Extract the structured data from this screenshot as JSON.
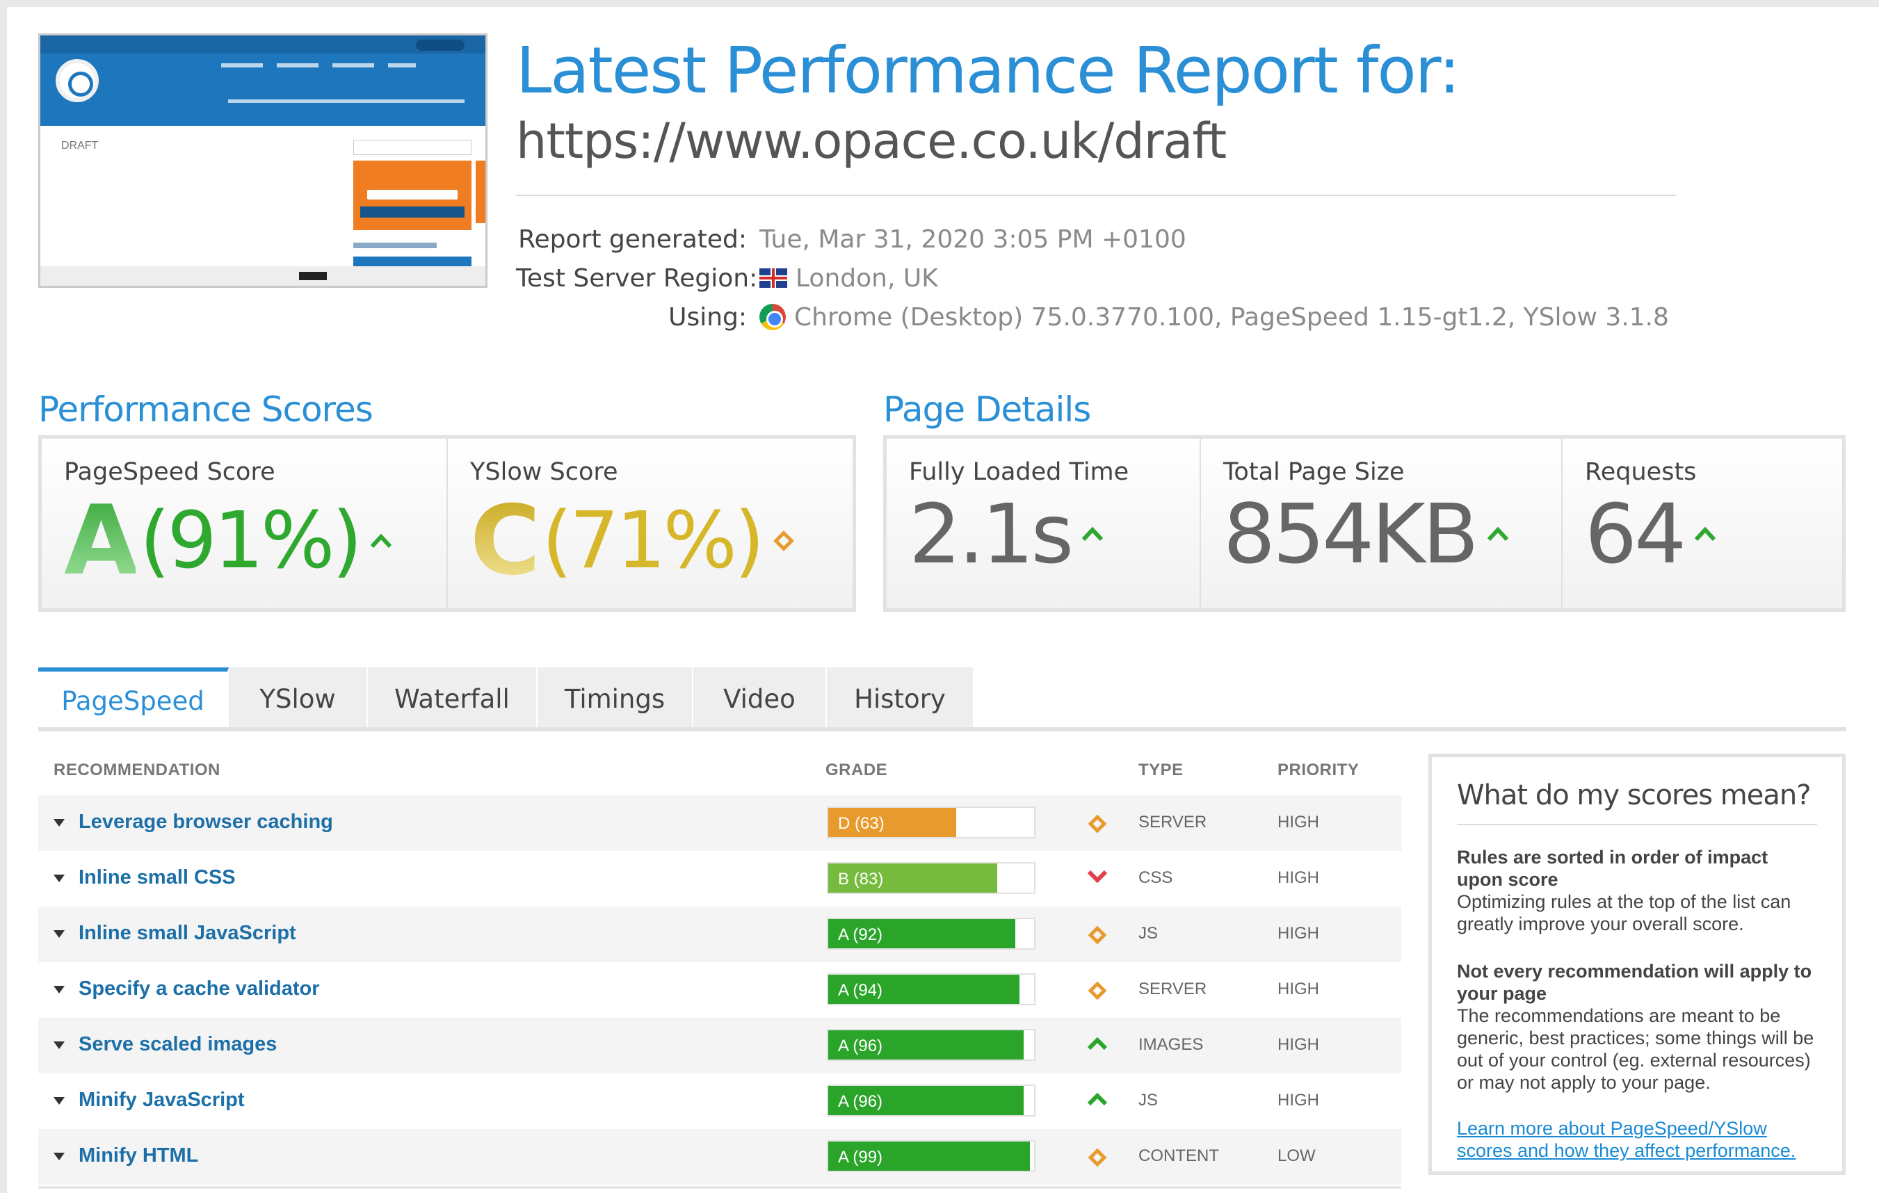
{
  "header": {
    "title": "Latest Performance Report for:",
    "url": "https://www.opace.co.uk/draft",
    "thumbnail_text": "DRAFT",
    "meta": [
      {
        "label": "Report generated:",
        "value": "Tue, Mar 31, 2020 3:05 PM +0100",
        "icon": "none"
      },
      {
        "label": "Test Server Region:",
        "value": "London, UK",
        "icon": "uk-flag-icon"
      },
      {
        "label": "Using:",
        "value": "Chrome (Desktop) 75.0.3770.100, PageSpeed 1.15-gt1.2, YSlow 3.1.8",
        "icon": "chrome-icon"
      }
    ]
  },
  "performance_scores": {
    "title": "Performance Scores",
    "pagespeed": {
      "label": "PageSpeed Score",
      "grade": "A",
      "percent": "(91%)",
      "trend": "up",
      "color": "#2fa830"
    },
    "yslow": {
      "label": "YSlow Score",
      "grade": "C",
      "percent": "(71%)",
      "trend": "neutral",
      "color": "#d6b72a"
    }
  },
  "page_details": {
    "title": "Page Details",
    "items": [
      {
        "label": "Fully Loaded Time",
        "value": "2.1s",
        "trend": "up"
      },
      {
        "label": "Total Page Size",
        "value": "854KB",
        "trend": "up"
      },
      {
        "label": "Requests",
        "value": "64",
        "trend": "up"
      }
    ]
  },
  "tabs": [
    "PageSpeed",
    "YSlow",
    "Waterfall",
    "Timings",
    "Video",
    "History"
  ],
  "active_tab": "PageSpeed",
  "table": {
    "headers": {
      "recommendation": "RECOMMENDATION",
      "grade": "GRADE",
      "type": "TYPE",
      "priority": "PRIORITY"
    },
    "rows": [
      {
        "recommendation": "Leverage browser caching",
        "grade": "D (63)",
        "score": 63,
        "color": "#e89a2c",
        "trend": "neutral",
        "type": "SERVER",
        "priority": "HIGH"
      },
      {
        "recommendation": "Inline small CSS",
        "grade": "B (83)",
        "score": 83,
        "color": "#76bb3d",
        "trend": "down",
        "type": "CSS",
        "priority": "HIGH"
      },
      {
        "recommendation": "Inline small JavaScript",
        "grade": "A (92)",
        "score": 92,
        "color": "#2aa52a",
        "trend": "neutral",
        "type": "JS",
        "priority": "HIGH"
      },
      {
        "recommendation": "Specify a cache validator",
        "grade": "A (94)",
        "score": 94,
        "color": "#2aa52a",
        "trend": "neutral",
        "type": "SERVER",
        "priority": "HIGH"
      },
      {
        "recommendation": "Serve scaled images",
        "grade": "A (96)",
        "score": 96,
        "color": "#2aa52a",
        "trend": "up",
        "type": "IMAGES",
        "priority": "HIGH"
      },
      {
        "recommendation": "Minify JavaScript",
        "grade": "A (96)",
        "score": 96,
        "color": "#2aa52a",
        "trend": "up",
        "type": "JS",
        "priority": "HIGH"
      },
      {
        "recommendation": "Minify HTML",
        "grade": "A (99)",
        "score": 99,
        "color": "#2aa52a",
        "trend": "neutral",
        "type": "CONTENT",
        "priority": "LOW"
      }
    ]
  },
  "side_box": {
    "title": "What do my scores mean?",
    "sections": [
      {
        "heading": "Rules are sorted in order of impact upon score",
        "body": "Optimizing rules at the top of the list can greatly improve your overall score."
      },
      {
        "heading": "Not every recommendation will apply to your page",
        "body": "The recommendations are meant to be generic, best practices; some things will be out of your control (eg. external resources) or may not apply to your page."
      }
    ],
    "link": "Learn more about PageSpeed/YSlow scores and how they affect performance."
  }
}
